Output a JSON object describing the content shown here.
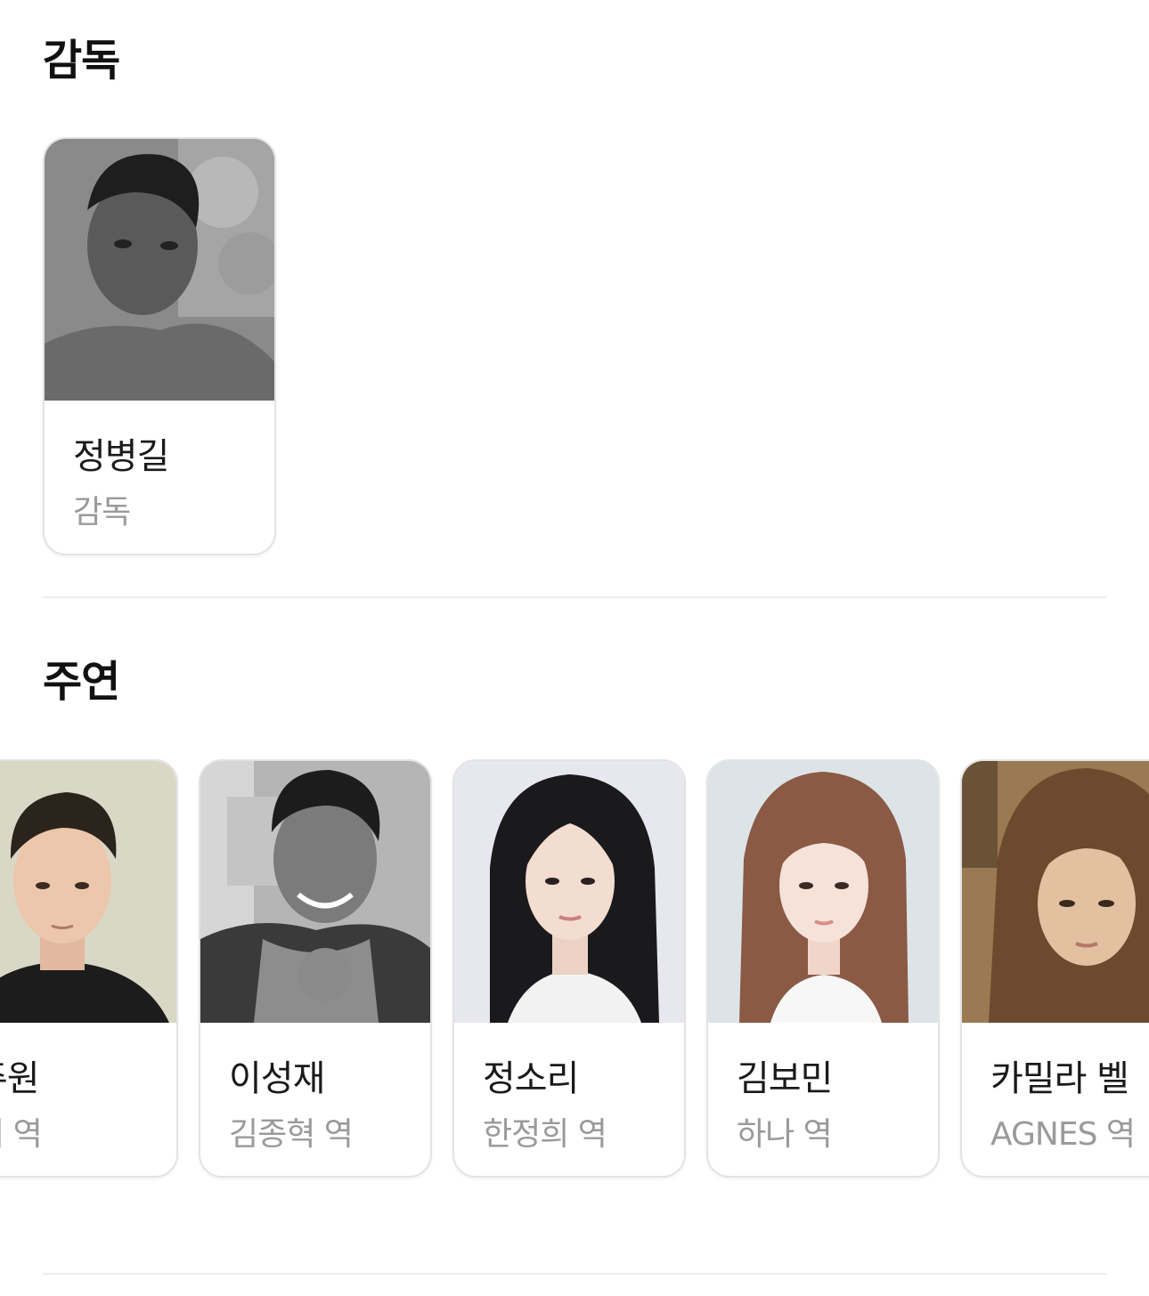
{
  "sections": {
    "director": {
      "title": "감독"
    },
    "cast": {
      "title": "주연"
    }
  },
  "director": {
    "name": "정병길",
    "role": "감독",
    "photo_icon": "person-photo-icon"
  },
  "cast": [
    {
      "name": "주원",
      "role": "터 역"
    },
    {
      "name": "이성재",
      "role": "김종혁 역"
    },
    {
      "name": "정소리",
      "role": "한정희 역"
    },
    {
      "name": "김보민",
      "role": "하나 역"
    },
    {
      "name": "카밀라 벨",
      "role": "AGNES 역"
    }
  ],
  "colors": {
    "divider": "#ececec",
    "card_border": "#e3e3e3",
    "role_text": "#9a9a9a",
    "name_text": "#1a1a1a"
  }
}
